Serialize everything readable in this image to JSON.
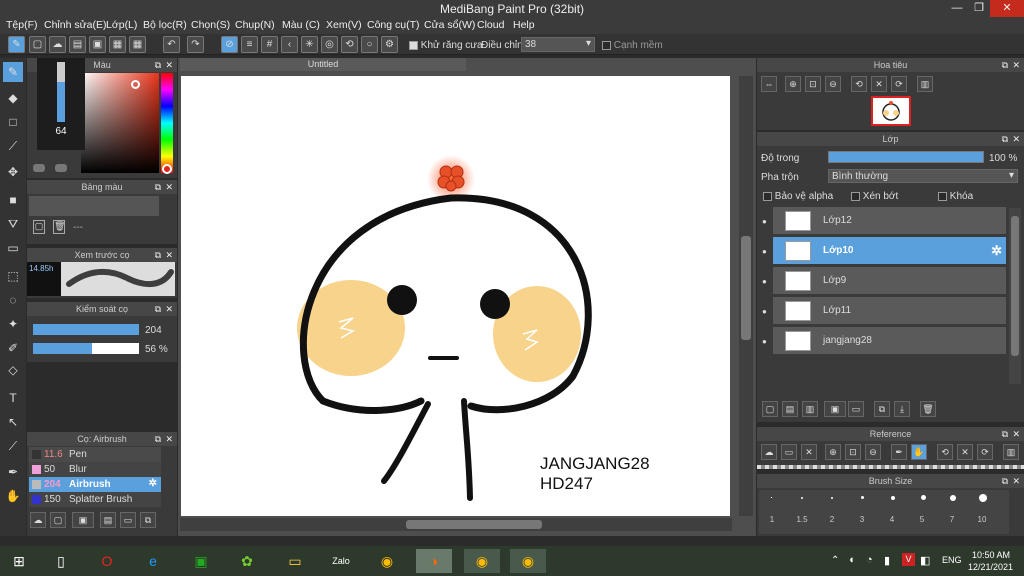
{
  "window": {
    "title": "MediBang Paint Pro (32bit)",
    "min": "—",
    "max": "❐",
    "close": "✕"
  },
  "menu": [
    "Tệp(F)",
    "Chỉnh sửa(E)",
    "Lớp(L)",
    "Bộ lọc(R)",
    "Chọn(S)",
    "Chụp(N)",
    "Màu (C)",
    "Xem(V)",
    "Công cụ(T)",
    "Cửa sổ(W)",
    "Cloud",
    "Help"
  ],
  "toolbar": {
    "antialias_label": "Khử răng cưa",
    "adjust_label": "Điều chỉnh",
    "adjust_value": "38",
    "snap_label": "Cạnh mềm"
  },
  "color_panel": {
    "title": "Màu",
    "value": "64",
    "colors": {
      "accent": "#5aa0dc",
      "red": "#e0241a"
    }
  },
  "palette_panel": {
    "title": "Bảng màu",
    "dash": "---"
  },
  "brush_preview": {
    "title": "Xem trước cọ",
    "size": "14.85h"
  },
  "brush_control": {
    "title": "Kiểm soát cọ",
    "size_value": "204",
    "opacity_value": "56 %",
    "opacity_frac": 0.56
  },
  "brush_list": {
    "title": "Cọ: Airbrush",
    "items": [
      {
        "size": "11.6",
        "name": "Pen",
        "color": "#333333"
      },
      {
        "size": "50",
        "name": "Blur",
        "color": "#f0a0d8"
      },
      {
        "size": "204",
        "name": "Airbrush",
        "color": "#bbbbbb"
      },
      {
        "size": "150",
        "name": "Splatter Brush",
        "color": "#3333cc"
      }
    ]
  },
  "canvas": {
    "tab": "Untitled",
    "signature_line1": "JANGJANG28",
    "signature_line2": "HD247"
  },
  "navigator": {
    "title": "Hoa tiêu"
  },
  "layers": {
    "title": "Lớp",
    "opacity_label": "Độ trong",
    "opacity_value": "100 %",
    "blend_label": "Pha trộn",
    "blend_value": "Bình thường",
    "protect_alpha": "Bảo vệ alpha",
    "clip": "Xén bớt",
    "lock": "Khóa",
    "rows": [
      {
        "name": "Lớp12"
      },
      {
        "name": "Lớp10"
      },
      {
        "name": "Lớp9"
      },
      {
        "name": "Lớp11"
      },
      {
        "name": "jangjang28"
      }
    ]
  },
  "reference": {
    "title": "Reference"
  },
  "brush_size": {
    "title": "Brush Size",
    "sizes": [
      "1",
      "1.5",
      "2",
      "3",
      "4",
      "5",
      "7",
      "10"
    ]
  },
  "taskbar": {
    "lang": "ENG",
    "time": "10:50 AM",
    "date": "12/21/2021"
  }
}
